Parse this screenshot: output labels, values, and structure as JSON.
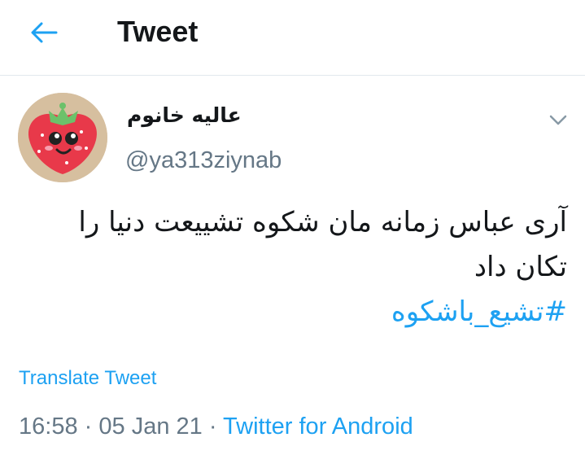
{
  "header": {
    "back_icon": "arrow-left-icon",
    "title": "Tweet",
    "accent_color": "#1da1f2"
  },
  "tweet": {
    "author_name": "عالیه خانوم",
    "author_handle": "@ya313ziynab",
    "avatar_icon": "strawberry-avatar",
    "menu_icon": "chevron-down-icon",
    "text_line1": "آری عباس زمانه مان شکوه تشییعت دنیا را",
    "text_line2": "تکان داد",
    "hashtag": "#تشیع_باشکوه",
    "translate_label": "Translate Tweet",
    "time": "16:58",
    "separator": "·",
    "date": "05 Jan 21",
    "source": "Twitter for Android"
  }
}
